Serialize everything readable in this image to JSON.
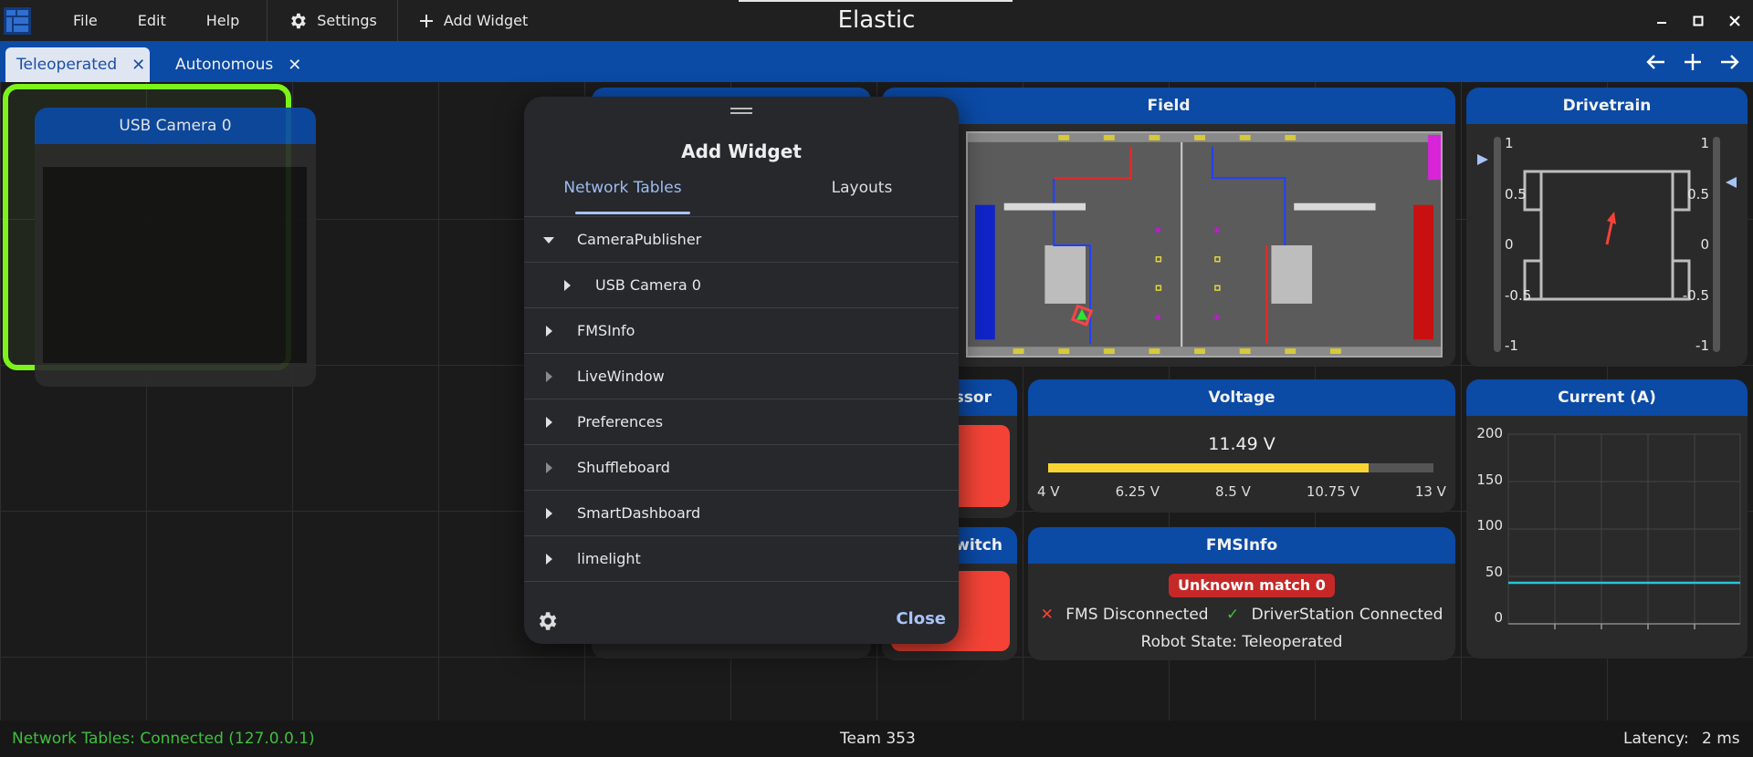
{
  "window": {
    "title": "Elastic"
  },
  "menu": {
    "file": "File",
    "edit": "Edit",
    "help": "Help",
    "settings": "Settings",
    "add_widget": "Add Widget"
  },
  "tabs": [
    {
      "label": "Teleoperated",
      "active": true
    },
    {
      "label": "Autonomous",
      "active": false
    }
  ],
  "widgets": {
    "camera": {
      "title": "USB Camera 0"
    },
    "field": {
      "title": "Field"
    },
    "drivetrain": {
      "title": "Drivetrain",
      "left_ticks": [
        "1",
        "0.5",
        "0",
        "-0.5",
        "-1"
      ],
      "right_ticks": [
        "1",
        "0.5",
        "0",
        "-0.5",
        "-1"
      ]
    },
    "compressor": {
      "title_fragment": "essor"
    },
    "switch": {
      "title_fragment": "Switch"
    },
    "voltage": {
      "title": "Voltage",
      "value_text": "11.49 V",
      "value": 11.49,
      "min": 4,
      "max": 13,
      "ticks": [
        "4 V",
        "6.25 V",
        "8.5 V",
        "10.75 V",
        "13 V"
      ],
      "fill_color": "#f9d534"
    },
    "fms": {
      "title": "FMSInfo",
      "match_badge": "Unknown match 0",
      "fms_status": "FMS Disconnected",
      "ds_status": "DriverStation Connected",
      "robot_state": "Robot State: Teleoperated"
    },
    "current": {
      "title": "Current (A)",
      "y_ticks": [
        "200",
        "150",
        "100",
        "50",
        "0"
      ],
      "line_color": "#29c5d6"
    }
  },
  "dialog": {
    "title": "Add Widget",
    "tabs": [
      "Network Tables",
      "Layouts"
    ],
    "tree": [
      {
        "label": "CameraPublisher",
        "expanded": true
      },
      {
        "label": "USB Camera 0",
        "child": true
      },
      {
        "label": "FMSInfo"
      },
      {
        "label": "LiveWindow"
      },
      {
        "label": "Preferences"
      },
      {
        "label": "Shuffleboard"
      },
      {
        "label": "SmartDashboard"
      },
      {
        "label": "limelight"
      }
    ],
    "close_label": "Close"
  },
  "status": {
    "network": "Network Tables: Connected (127.0.0.1)",
    "team": "Team 353",
    "latency_label": "Latency:",
    "latency_value": "2 ms"
  },
  "colors": {
    "accent_blue": "#0b4aa5",
    "highlight_green": "#7cf31b",
    "status_green": "#3fbf3f",
    "alert_red": "#f44336"
  }
}
